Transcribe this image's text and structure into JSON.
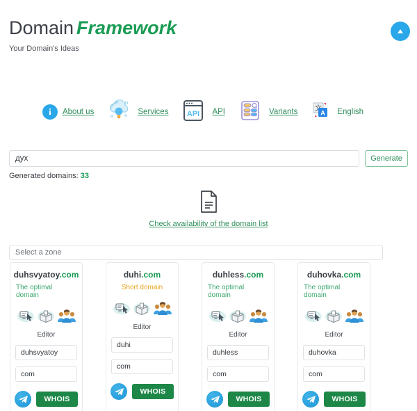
{
  "header": {
    "title_part1": "Domain",
    "title_part2": "Framework",
    "tagline": "Your Domain's Ideas",
    "scroll_top_icon": "arrow-up-icon"
  },
  "nav": {
    "items": [
      {
        "icon": "info-circle-icon",
        "label": "About us",
        "underlined": true
      },
      {
        "icon": "cloud-idea-icon",
        "label": "Services",
        "underlined": true
      },
      {
        "icon": "api-browser-icon",
        "label": "API",
        "underlined": true
      },
      {
        "icon": "list-search-icon",
        "label": "Variants",
        "underlined": true
      },
      {
        "icon": "translate-icon",
        "label": "English",
        "underlined": false
      }
    ]
  },
  "search": {
    "value": "дух",
    "placeholder": "",
    "generate_label": "Generate",
    "generated_label": "Generated domains:",
    "generated_count": "33"
  },
  "check": {
    "icon": "document-lines-icon",
    "link_label": "Check availability of the domain list"
  },
  "zone": {
    "placeholder": "Select a zone",
    "icon": "chevron-down-icon"
  },
  "cards": [
    {
      "name": "duhsvyatoy",
      "tld": ".com",
      "note": "The optimal domain",
      "note_type": "optimal",
      "icons": [
        "click-cursor-icon",
        "package-box-icon",
        "people-group-icon"
      ],
      "editor_label": "Editor",
      "field_name": "duhsvyatoy",
      "field_zone": "com",
      "telegram_icon": "telegram-icon",
      "whois_label": "WHOIS"
    },
    {
      "name": "duhi",
      "tld": ".com",
      "note": "Short domain",
      "note_type": "short",
      "icons": [
        "click-cursor-icon",
        "package-box-icon",
        "people-group-icon"
      ],
      "editor_label": "Editor",
      "field_name": "duhi",
      "field_zone": "com",
      "telegram_icon": "telegram-icon",
      "whois_label": "WHOIS"
    },
    {
      "name": "duhless",
      "tld": ".com",
      "note": "The optimal domain",
      "note_type": "optimal",
      "icons": [
        "click-cursor-icon",
        "package-box-icon",
        "people-group-icon"
      ],
      "editor_label": "Editor",
      "field_name": "duhless",
      "field_zone": "com",
      "telegram_icon": "telegram-icon",
      "whois_label": "WHOIS"
    },
    {
      "name": "duhovka",
      "tld": ".com",
      "note": "The optimal domain",
      "note_type": "optimal",
      "icons": [
        "click-cursor-icon",
        "package-box-icon",
        "people-group-icon"
      ],
      "editor_label": "Editor",
      "field_name": "duhovka",
      "field_zone": "com",
      "telegram_icon": "telegram-icon",
      "whois_label": "WHOIS"
    }
  ],
  "colors": {
    "brand_green": "#1a9c54",
    "link_green": "#2f8f5b",
    "accent_blue": "#2aa7e8",
    "whois_green": "#1d8748",
    "short_orange": "#e8a317"
  }
}
